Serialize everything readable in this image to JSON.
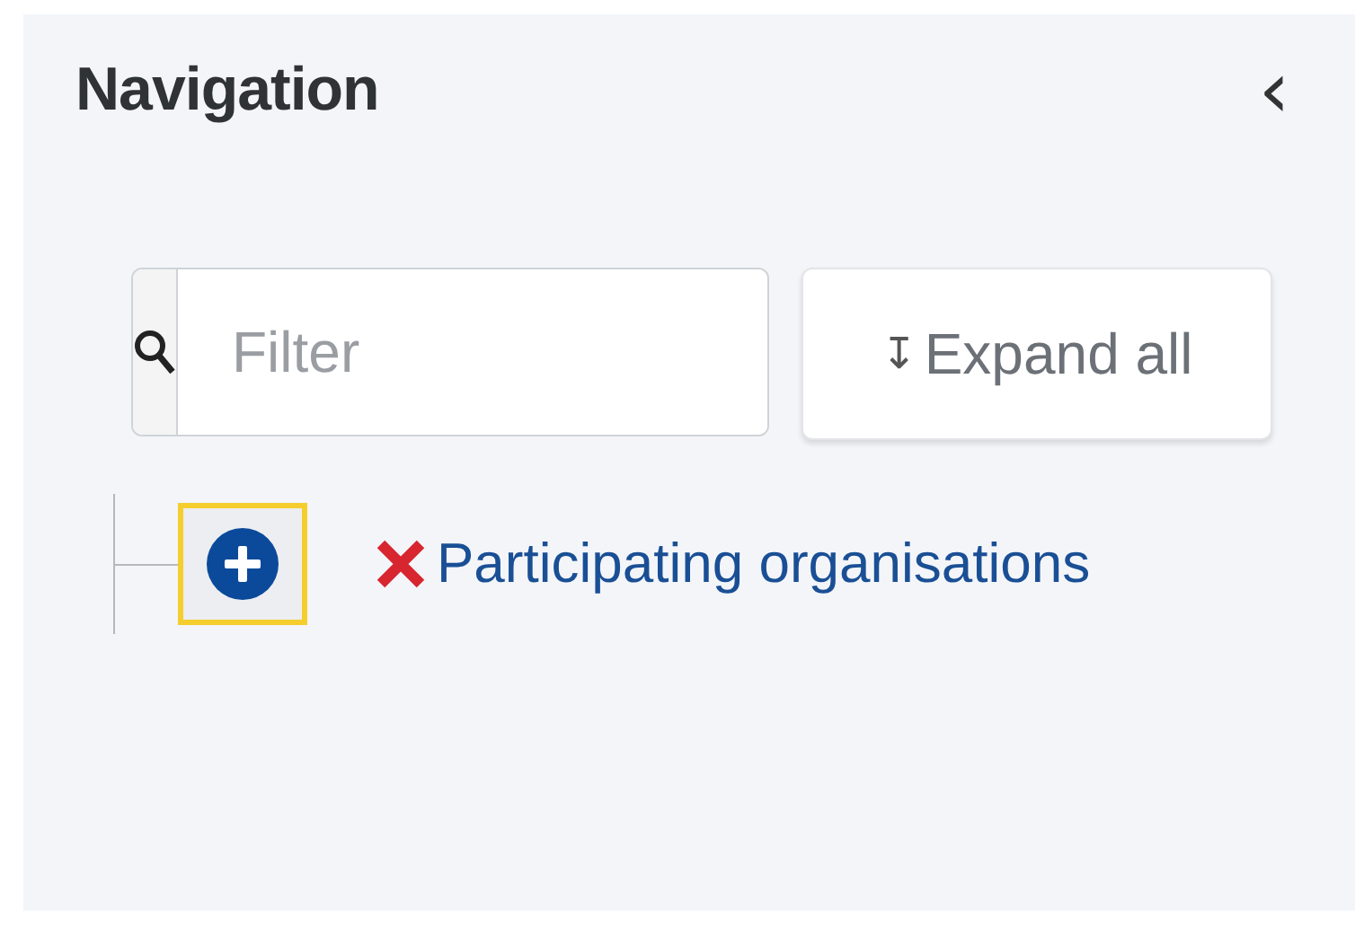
{
  "panel": {
    "title": "Navigation",
    "collapse_icon": "‹"
  },
  "filter": {
    "placeholder": "Filter"
  },
  "expand_button": {
    "icon": "↧",
    "label": "Expand all"
  },
  "tree": {
    "items": [
      {
        "label": "Participating organisations",
        "expanded": false,
        "focused": true,
        "valid": false
      }
    ]
  }
}
